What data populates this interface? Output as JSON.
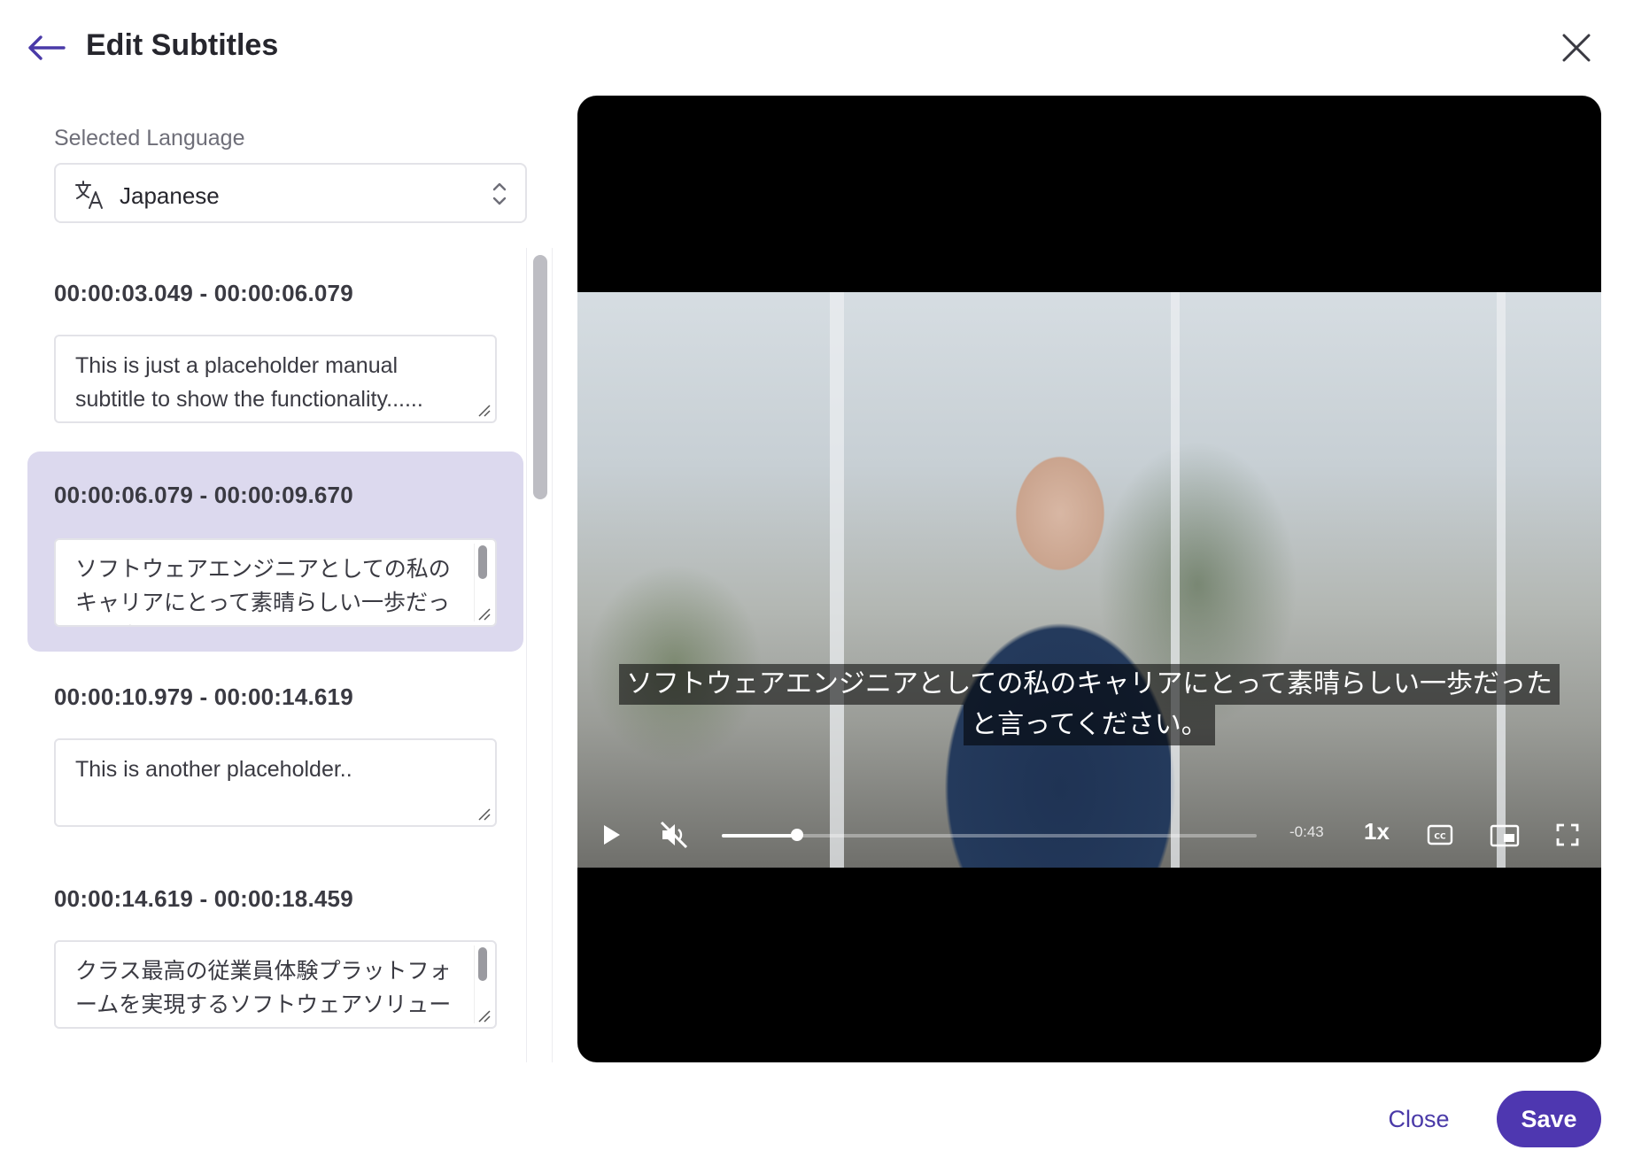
{
  "header": {
    "title": "Edit Subtitles"
  },
  "language": {
    "label": "Selected Language",
    "value": "Japanese"
  },
  "subtitles": [
    {
      "time": "00:00:03.049 - 00:00:06.079",
      "text": "This is just a placeholder manual subtitle to show the functionality......",
      "selected": false
    },
    {
      "time": "00:00:06.079 - 00:00:09.670",
      "text": "ソフトウェアエンジニアとしての私のキャリアにとって素晴らしい一歩だったと言ってください",
      "selected": true
    },
    {
      "time": "00:00:10.979 - 00:00:14.619",
      "text": "This is another placeholder..",
      "selected": false
    },
    {
      "time": "00:00:14.619 - 00:00:18.459",
      "text": "クラス最高の従業員体験プラットフォームを実現するソフトウェアソリューション",
      "selected": false
    }
  ],
  "video": {
    "caption_lines": [
      "ソフトウェアエンジニアとしての私のキャリアにとって素晴らしい一歩だった",
      "と言ってください。"
    ],
    "time_remaining": "-0:43",
    "speed": "1x",
    "progress": 0.14,
    "icons": [
      "play-icon",
      "muted-icon",
      "cc-icon",
      "picture-in-picture-icon",
      "fullscreen-icon"
    ]
  },
  "footer": {
    "close_label": "Close",
    "save_label": "Save"
  },
  "colors": {
    "accent": "#4e37b0",
    "selected_bg": "#dcd9ee"
  }
}
